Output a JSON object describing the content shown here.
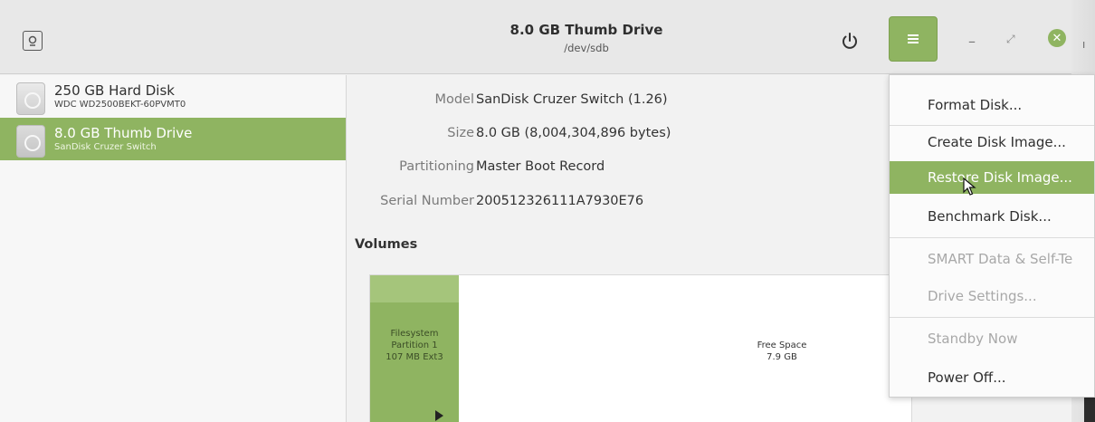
{
  "header": {
    "title": "8.0 GB Thumb Drive",
    "subtitle": "/dev/sdb",
    "edge_fragment": "ı"
  },
  "sidebar": {
    "items": [
      {
        "name": "250 GB Hard Disk",
        "sub": "WDC WD2500BEKT-60PVMT0",
        "selected": false
      },
      {
        "name": "8.0 GB Thumb Drive",
        "sub": "SanDisk Cruzer Switch",
        "selected": true
      }
    ]
  },
  "properties": [
    {
      "key": "Model",
      "value": "SanDisk Cruzer Switch (1.26)"
    },
    {
      "key": "Size",
      "value": "8.0 GB (8,004,304,896 bytes)"
    },
    {
      "key": "Partitioning",
      "value": "Master Boot Record"
    },
    {
      "key": "Serial Number",
      "value": "200512326111A7930E76"
    }
  ],
  "volumes": {
    "label": "Volumes",
    "partition": {
      "line1": "Filesystem",
      "line2": "Partition 1",
      "line3": "107 MB Ext3"
    },
    "free_space": {
      "line1": "Free Space",
      "line2": "7.9 GB"
    }
  },
  "menu": {
    "items": [
      {
        "label": "Format Disk...",
        "state": "normal"
      },
      {
        "label": "Create Disk Image...",
        "state": "normal"
      },
      {
        "label": "Restore Disk Image...",
        "state": "highlighted"
      },
      {
        "label": "Benchmark Disk...",
        "state": "normal"
      },
      {
        "label": "SMART Data & Self-Te",
        "state": "disabled"
      },
      {
        "label": "Drive Settings...",
        "state": "disabled"
      },
      {
        "label": "Standby Now",
        "state": "disabled"
      },
      {
        "label": "Power Off...",
        "state": "normal"
      }
    ]
  },
  "icons": {
    "app": "disks-app-icon",
    "power": "power-icon",
    "menu": "hamburger-menu-icon",
    "minimize": "minimize-icon",
    "maximize": "maximize-icon",
    "close": "close-icon",
    "cursor": "mouse-pointer-icon"
  },
  "colors": {
    "accent": "#8fb461",
    "accent_light": "#a5c57b"
  }
}
